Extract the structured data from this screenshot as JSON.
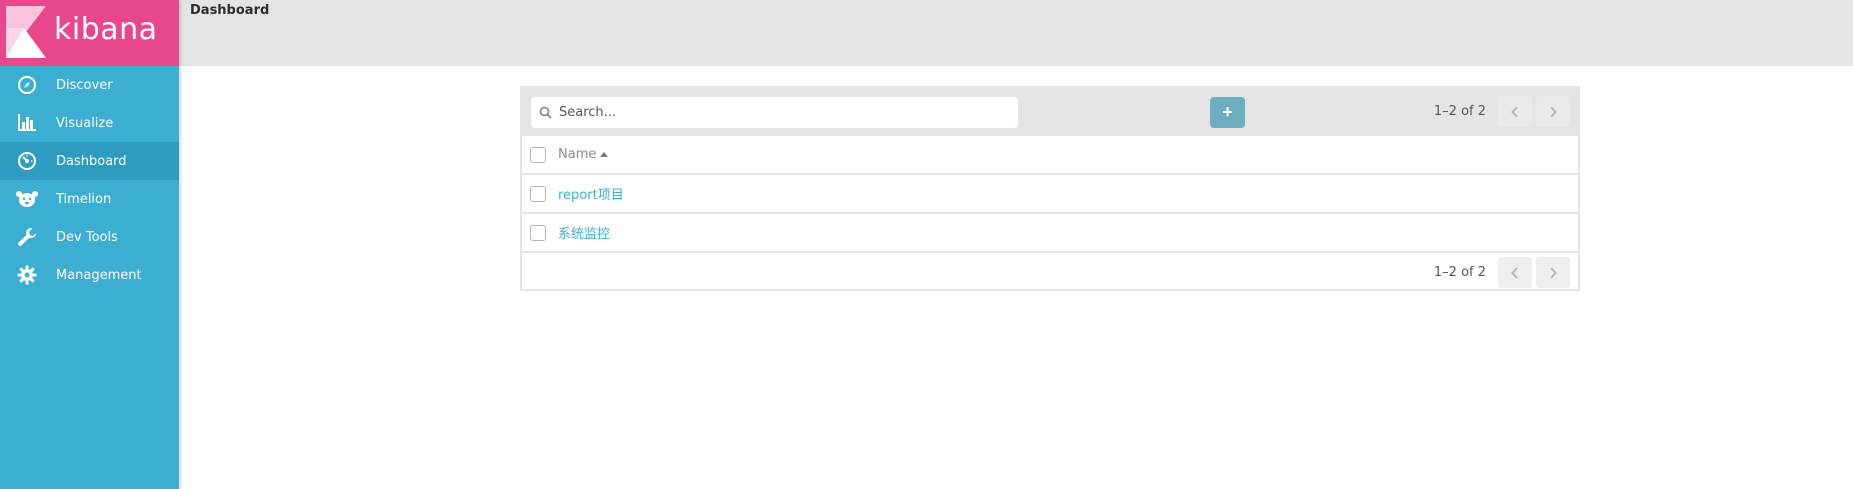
{
  "app": {
    "logo_text": "kibana"
  },
  "sidebar": {
    "items": [
      {
        "label": "Discover",
        "icon": "compass-icon"
      },
      {
        "label": "Visualize",
        "icon": "bar-chart-icon"
      },
      {
        "label": "Dashboard",
        "icon": "dashboard-gauge-icon",
        "active": true
      },
      {
        "label": "Timelion",
        "icon": "timelion-bear-icon"
      },
      {
        "label": "Dev Tools",
        "icon": "wrench-icon"
      },
      {
        "label": "Management",
        "icon": "gear-icon"
      }
    ]
  },
  "header": {
    "title": "Dashboard"
  },
  "toolbar": {
    "search_placeholder": "Search...",
    "add_label": "+",
    "pager_text": "1–2 of 2"
  },
  "table": {
    "column_name": "Name",
    "rows": [
      {
        "name": "report项目"
      },
      {
        "name": "系统监控"
      }
    ],
    "footer_pager_text": "1–2 of 2"
  },
  "colors": {
    "sidebar": "#3caed2",
    "logo": "#e8488b",
    "accent": "#3caed2",
    "add_button": "#6eadc1"
  }
}
